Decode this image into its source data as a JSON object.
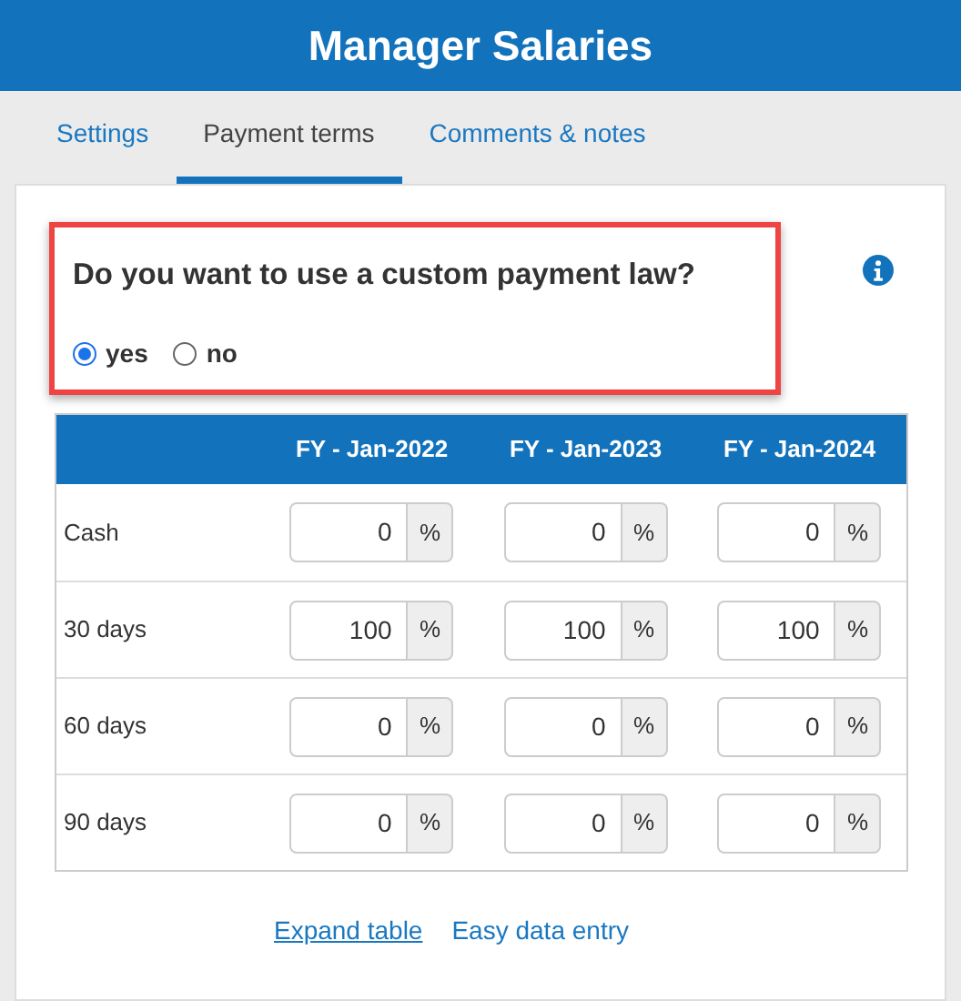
{
  "header": {
    "title": "Manager Salaries"
  },
  "tabs": [
    {
      "label": "Settings",
      "selected": false
    },
    {
      "label": "Payment terms",
      "selected": true
    },
    {
      "label": "Comments & notes",
      "selected": false
    }
  ],
  "question": {
    "text": "Do you want to use a custom payment law?",
    "highlighted": true,
    "options": [
      {
        "label": "yes",
        "selected": true
      },
      {
        "label": "no",
        "selected": false
      }
    ]
  },
  "table": {
    "columns": [
      "FY - Jan-2022",
      "FY - Jan-2023",
      "FY - Jan-2024"
    ],
    "unit": "%",
    "rows": [
      {
        "label": "Cash",
        "values": [
          "0",
          "0",
          "0"
        ]
      },
      {
        "label": "30 days",
        "values": [
          "100",
          "100",
          "100"
        ]
      },
      {
        "label": "60 days",
        "values": [
          "0",
          "0",
          "0"
        ]
      },
      {
        "label": "90 days",
        "values": [
          "0",
          "0",
          "0"
        ]
      }
    ]
  },
  "links": [
    {
      "label": "Expand table",
      "underlined": true
    },
    {
      "label": "Easy data entry",
      "underlined": false
    }
  ]
}
